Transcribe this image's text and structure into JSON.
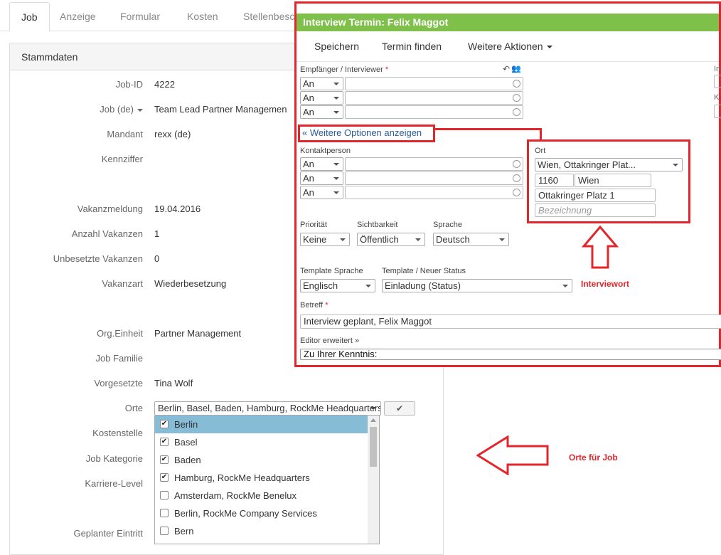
{
  "tabs": [
    "Job",
    "Anzeige",
    "Formular",
    "Kosten",
    "Stellenbesc"
  ],
  "panel": {
    "title": "Stammdaten"
  },
  "fields": [
    {
      "label": "Job-ID",
      "value": "4222"
    },
    {
      "label": "Job (de)",
      "value": "Team Lead Partner Managemen"
    },
    {
      "label": "Mandant",
      "value": "rexx (de)"
    },
    {
      "label": "Kennziffer",
      "value": ""
    },
    {
      "label": "Vakanzmeldung",
      "value": "19.04.2016"
    },
    {
      "label": "Anzahl Vakanzen",
      "value": "1"
    },
    {
      "label": "Unbesetzte Vakanzen",
      "value": "0"
    },
    {
      "label": "Vakanzart",
      "value": "Wiederbesetzung"
    },
    {
      "label": "Org.Einheit",
      "value": "Partner Management"
    },
    {
      "label": "Job Familie",
      "value": ""
    },
    {
      "label": "Vorgesetzte",
      "value": "Tina Wolf"
    },
    {
      "label": "Orte",
      "value": ""
    },
    {
      "label": "Kostenstelle",
      "value": ""
    },
    {
      "label": "Job Kategorie",
      "value": ""
    },
    {
      "label": "Karriere-Level",
      "value": ""
    },
    {
      "label": "Geplanter Eintritt",
      "value": ""
    }
  ],
  "orte": {
    "selected": "Berlin, Basel, Baden, Hamburg, RockMe Headquarters",
    "confirm_icon": "check-icon",
    "options": [
      {
        "label": "Berlin",
        "checked": true
      },
      {
        "label": "Basel",
        "checked": true
      },
      {
        "label": "Baden",
        "checked": true
      },
      {
        "label": "Hamburg, RockMe Headquarters",
        "checked": true
      },
      {
        "label": "Amsterdam, RockMe Benelux",
        "checked": false
      },
      {
        "label": "Berlin, RockMe Company Services",
        "checked": false
      },
      {
        "label": "Bern",
        "checked": false
      }
    ]
  },
  "modal": {
    "title": "Interview Termin: Felix Maggot",
    "toolbar": {
      "save": "Speichern",
      "find": "Termin finden",
      "more": "Weitere Aktionen"
    },
    "recipients_label": "Empfänger / Interviewer",
    "required_mark": "*",
    "recipient_prefix": [
      "An",
      "An",
      "An"
    ],
    "more_options": "Weitere Optionen anzeigen",
    "contact_label": "Kontaktperson",
    "contact_prefix": [
      "An",
      "An",
      "An"
    ],
    "ort": {
      "label": "Ort",
      "select": "Wien, Ottakringer Plat...",
      "zip": "1160",
      "city": "Wien",
      "street": "Ottakringer Platz 1",
      "description_placeholder": "Bezeichnung"
    },
    "priority": {
      "label": "Priorität",
      "value": "Keine"
    },
    "visibility": {
      "label": "Sichtbarkeit",
      "value": "Öffentlich"
    },
    "language": {
      "label": "Sprache",
      "value": "Deutsch"
    },
    "template_language": {
      "label": "Template Sprache",
      "value": "Englisch"
    },
    "template_status": {
      "label": "Template / Neuer Status",
      "value": "Einladung (Status)"
    },
    "subject": {
      "label": "Betreff",
      "value": "Interview geplant, Felix Maggot"
    },
    "editor": {
      "label": "Editor erweitert",
      "preview": "Zu Ihrer Kenntnis:"
    },
    "edge_labels": [
      "In",
      "K"
    ]
  },
  "annotations": {
    "interview_place": "Interviewort",
    "job_places": "Orte für Job",
    "color": "#e3262b"
  }
}
